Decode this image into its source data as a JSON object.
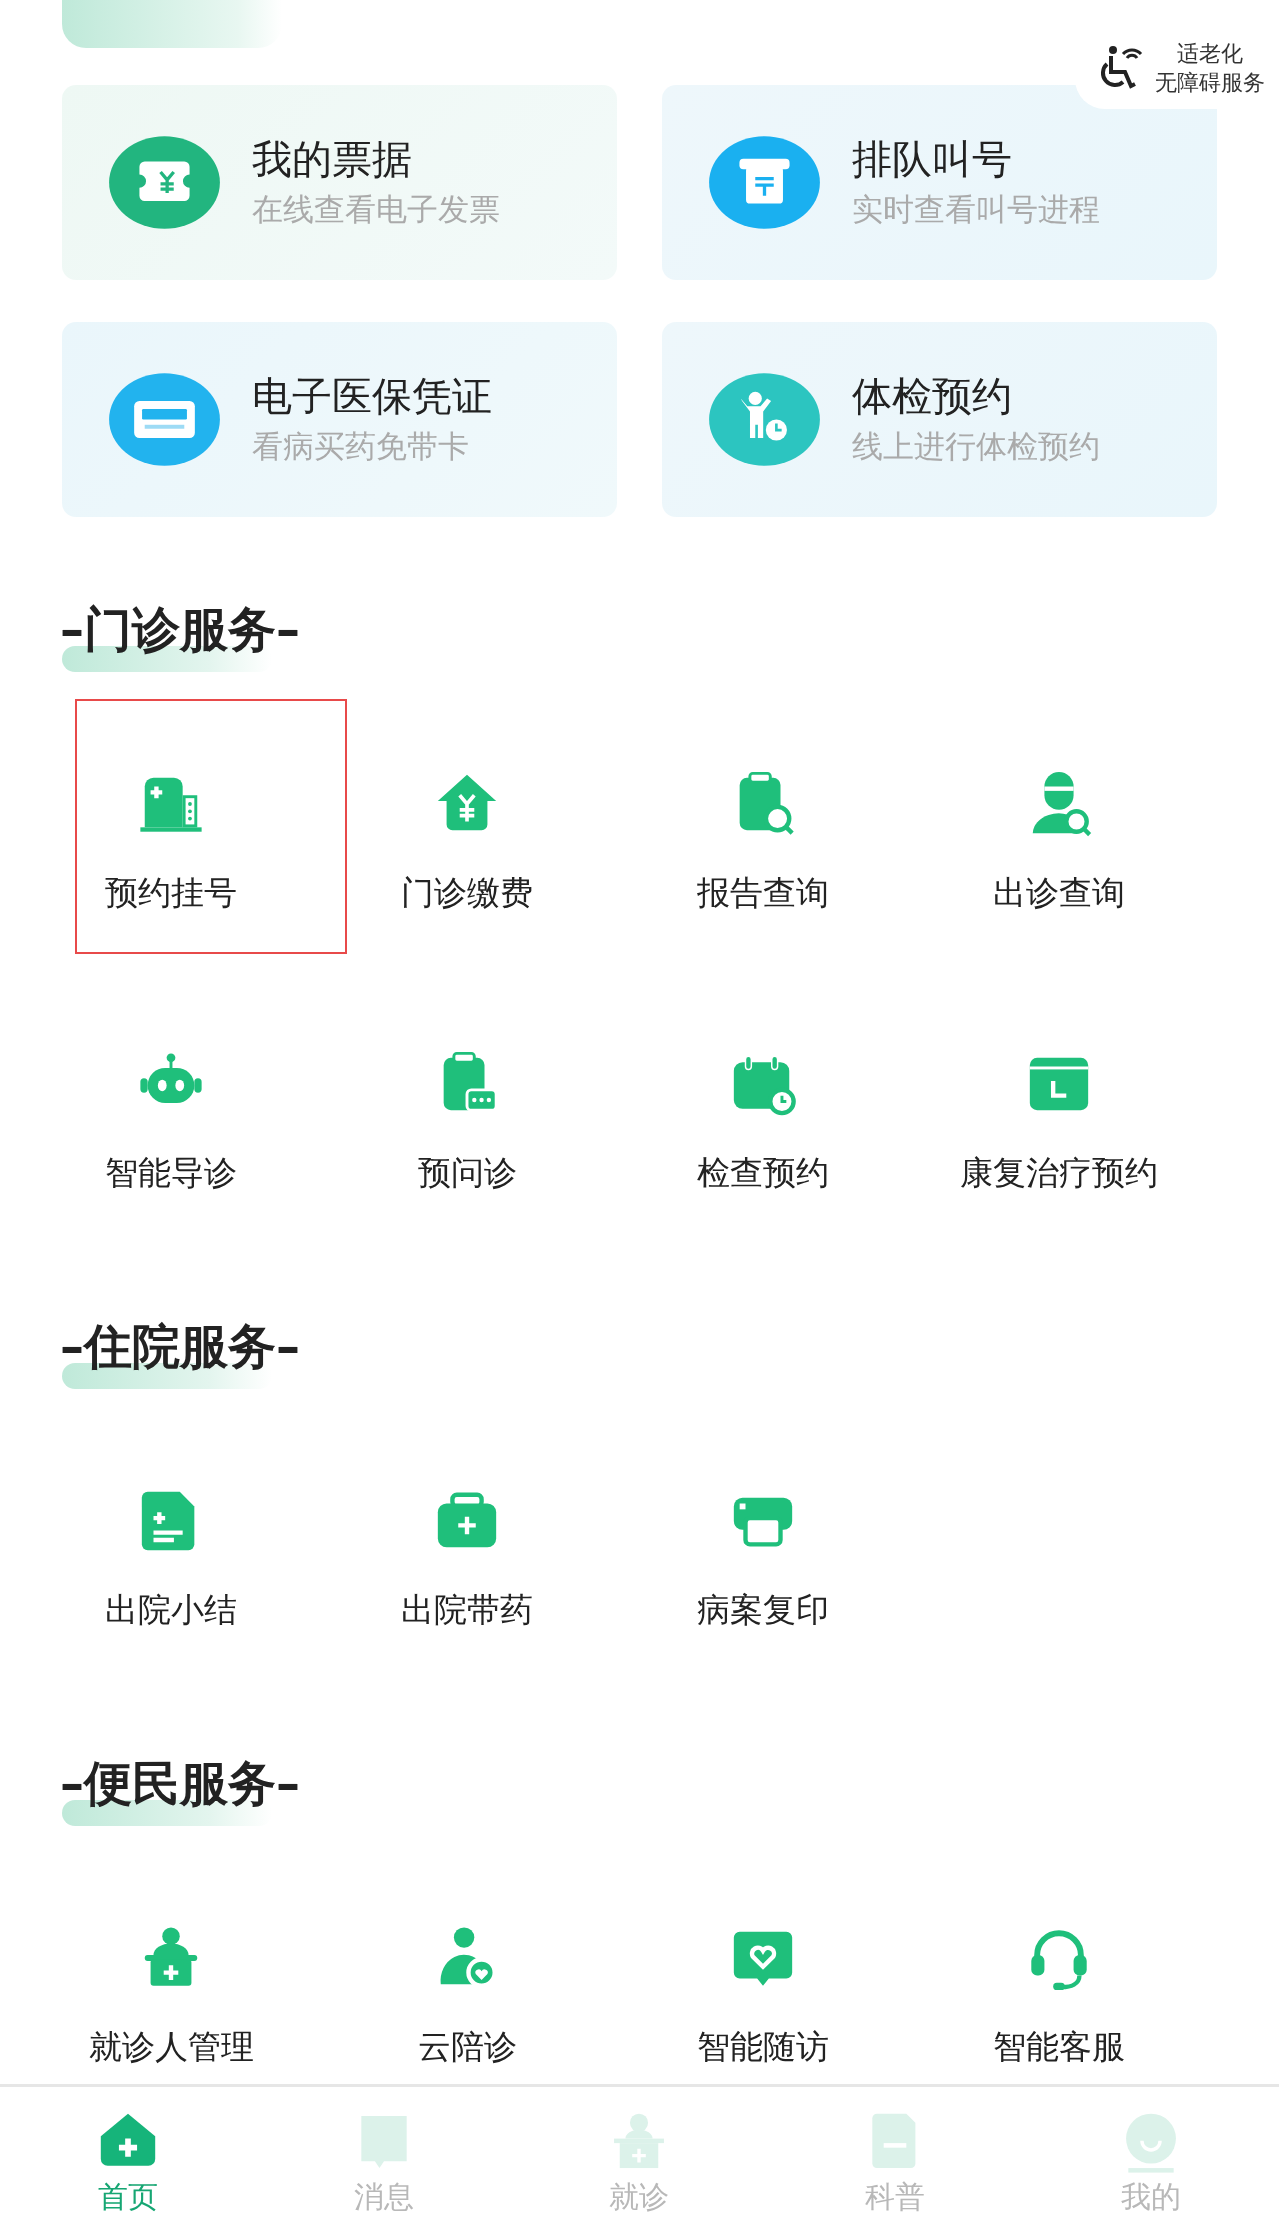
{
  "accessibility_badge": {
    "line_1": "适老化",
    "line_2": "无障碍服务"
  },
  "featured_cards": [
    {
      "title": "我的票据",
      "subtitle": "在线查看电子发票",
      "color": "#22b57f"
    },
    {
      "title": "排队叫号",
      "subtitle": "实时查看叫号进程",
      "color": "#1ab0f0"
    },
    {
      "title": "电子医保凭证",
      "subtitle": "看病买药免带卡",
      "color": "#22b3ee"
    },
    {
      "title": "体检预约",
      "subtitle": "线上进行体检预约",
      "color": "#2cc5c0"
    }
  ],
  "sections": [
    {
      "title": "–门诊服务–",
      "items": [
        {
          "label": "预约挂号",
          "selected": true
        },
        {
          "label": "门诊缴费",
          "selected": false
        },
        {
          "label": "报告查询",
          "selected": false
        },
        {
          "label": "出诊查询",
          "selected": false
        },
        {
          "label": "智能导诊",
          "selected": false
        },
        {
          "label": "预问诊",
          "selected": false
        },
        {
          "label": "检查预约",
          "selected": false
        },
        {
          "label": "康复治疗预约",
          "selected": false
        }
      ]
    },
    {
      "title": "–住院服务–",
      "items": [
        {
          "label": "出院小结",
          "selected": false
        },
        {
          "label": "出院带药",
          "selected": false
        },
        {
          "label": "病案复印",
          "selected": false
        }
      ]
    },
    {
      "title": "–便民服务–",
      "items": [
        {
          "label": "就诊人管理",
          "selected": false
        },
        {
          "label": "云陪诊",
          "selected": false
        },
        {
          "label": "智能随访",
          "selected": false
        },
        {
          "label": "智能客服",
          "selected": false
        }
      ]
    }
  ],
  "bottom_nav": [
    {
      "label": "首页",
      "selected": true
    },
    {
      "label": "消息",
      "selected": false
    },
    {
      "label": "就诊",
      "selected": false
    },
    {
      "label": "科普",
      "selected": false
    },
    {
      "label": "我的",
      "selected": false
    }
  ]
}
